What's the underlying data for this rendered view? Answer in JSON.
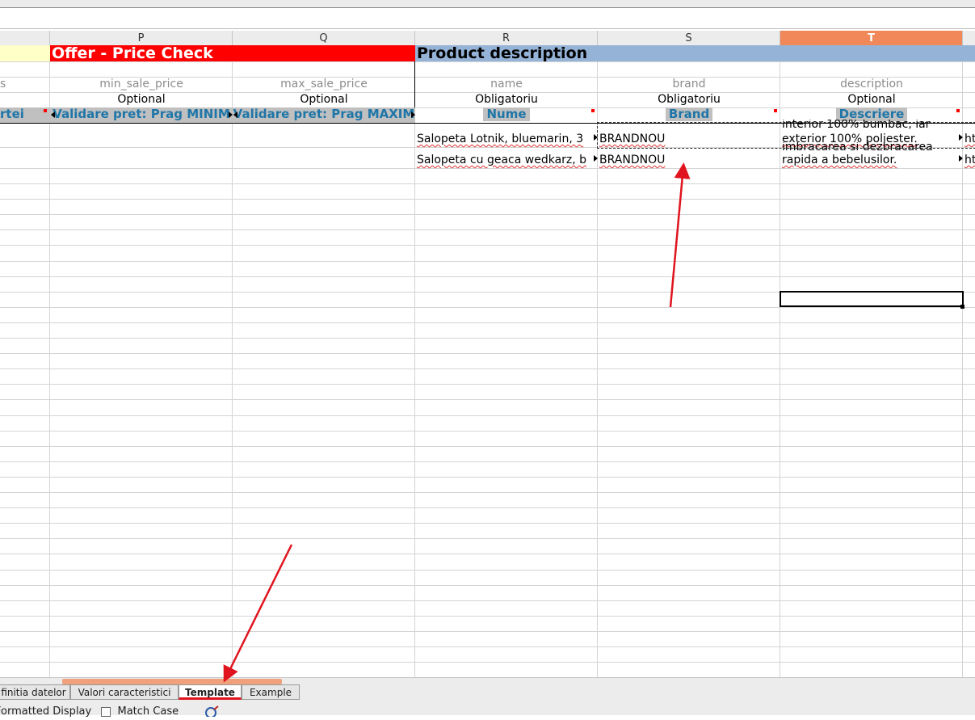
{
  "columns": [
    {
      "letter": "P",
      "selected": false
    },
    {
      "letter": "Q",
      "selected": false
    },
    {
      "letter": "R",
      "selected": false
    },
    {
      "letter": "S",
      "selected": false
    },
    {
      "letter": "T",
      "selected": true
    }
  ],
  "bands": {
    "offer": "Offer - Price Check",
    "product": "Product description"
  },
  "field_names": {
    "prev": "s",
    "p": "min_sale_price",
    "q": "max_sale_price",
    "r": "name",
    "s": "brand",
    "t": "description"
  },
  "requirements": {
    "p": "Optional",
    "q": "Optional",
    "r": "Obligatoriu",
    "s": "Obligatoriu",
    "t": "Optional"
  },
  "header_labels": {
    "prev": "rtei",
    "p": "Validare pret: Prag MINIM",
    "q": "Validare pret: Prag MAXIM",
    "r": "Nume",
    "s": "Brand",
    "t": "Descriere"
  },
  "rows": [
    {
      "name": "Salopeta Lotnik, bluemarin, 3",
      "brand": "BRANDNOU",
      "description_top": "interior 100% bumbac, iar",
      "description": "exterior 100% poliester.",
      "next": "ht"
    },
    {
      "name": "Salopeta cu geaca wedkarz, b",
      "brand": "BRANDNOU",
      "description_top": "imbracarea si dezbracarea",
      "description": "rapida a bebelusilor.",
      "next": "ht"
    }
  ],
  "sheet_tabs": [
    {
      "label": "finitia datelor",
      "active": false
    },
    {
      "label": "Valori caracteristici",
      "active": false
    },
    {
      "label": "Template",
      "active": true
    },
    {
      "label": "Example",
      "active": false
    }
  ],
  "find_bar": {
    "formatted_display": "Formatted Display",
    "match_case": "Match Case"
  },
  "colors": {
    "offer_band": "#ff0000",
    "product_band": "#95b3d7",
    "header_label_text": "#1f76a8",
    "selected_column": "#f0885a",
    "annotation_arrow": "#e0141e"
  }
}
